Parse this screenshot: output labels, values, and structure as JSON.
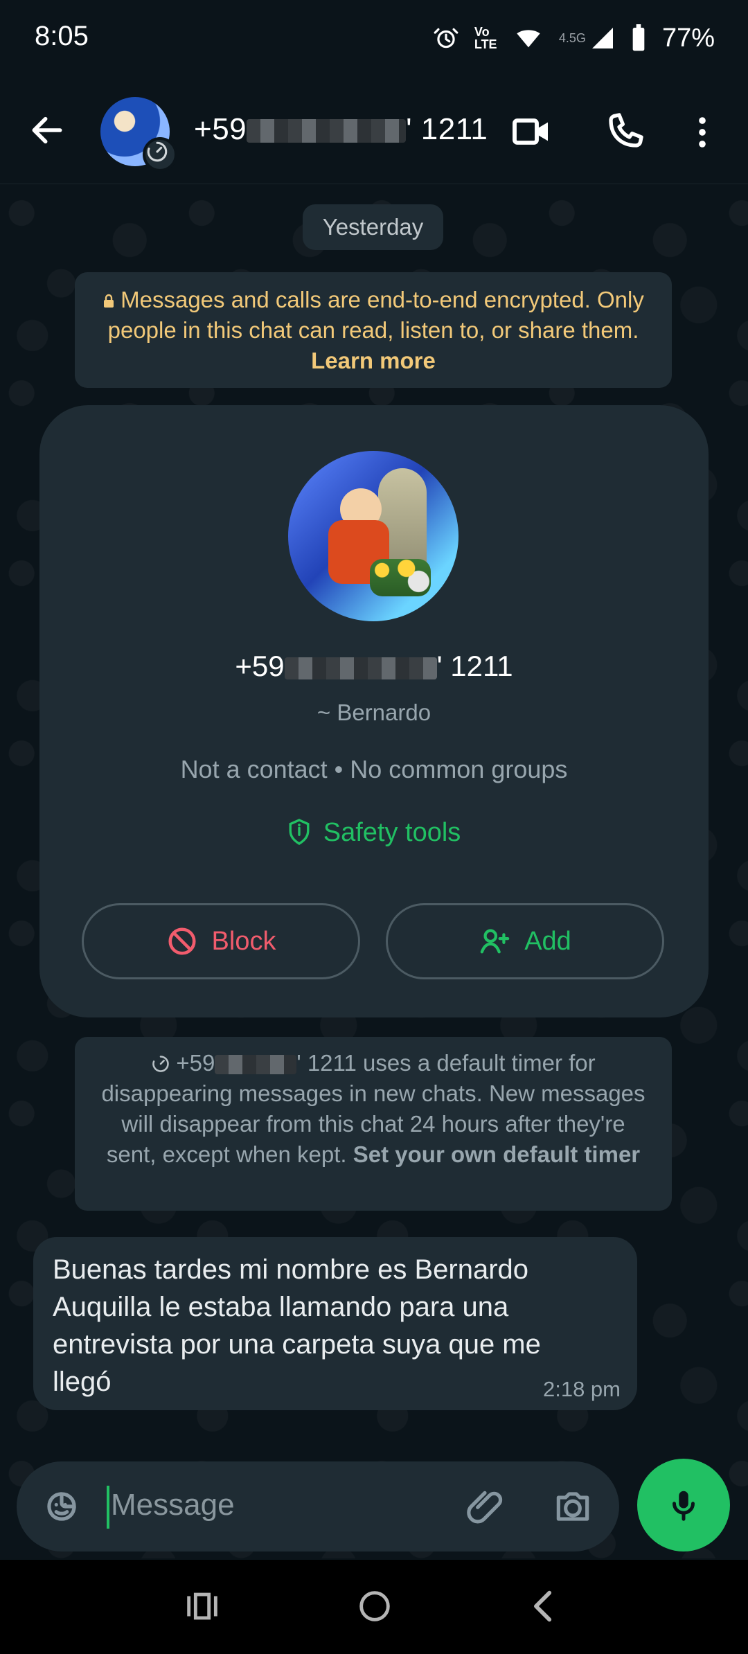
{
  "statusbar": {
    "time": "8:05",
    "network": "4.5G",
    "lte": "Vo LTE",
    "battery": "77%"
  },
  "header": {
    "contact_number_prefix": "+59",
    "contact_number_suffix": "' 1211"
  },
  "chat": {
    "day_label": "Yesterday",
    "encryption": {
      "text": "Messages and calls are end-to-end encrypted. Only people in this chat can read, listen to, or share them.",
      "link": "Learn more"
    },
    "profile": {
      "number_prefix": "+59",
      "number_suffix": "' 1211",
      "alias": "~ Bernardo",
      "meta": "Not a contact • No common groups",
      "safety_tools": "Safety tools",
      "block_label": "Block",
      "add_label": "Add"
    },
    "timer_notice": {
      "number_prefix": "+59",
      "number_suffix": "' 1211",
      "text": "uses a default timer for disappearing messages in new chats. New messages will disappear from this chat 24 hours after they're sent, except when kept.",
      "link": "Set your own default timer"
    },
    "message": {
      "text": "Buenas tardes mi nombre es Bernardo Auquilla le estaba llamando para una entrevista por una carpeta suya que me llegó",
      "time": "2:18 pm"
    }
  },
  "composer": {
    "placeholder": "Message"
  },
  "colors": {
    "background": "#0b141a",
    "surface": "#1f2c34",
    "accent_green": "#21c063",
    "warning_yellow": "#f2c979",
    "danger_red": "#f15c6d"
  },
  "icons": {
    "back": "back-arrow-icon",
    "video": "video-call-icon",
    "call": "phone-icon",
    "more": "more-vertical-icon",
    "lock": "lock-icon",
    "safety": "shield-icon",
    "block": "block-icon",
    "add": "add-contact-icon",
    "timer": "timer-icon",
    "emoji": "sticker-icon",
    "attach": "attach-icon",
    "camera": "camera-icon",
    "mic": "microphone-icon"
  }
}
